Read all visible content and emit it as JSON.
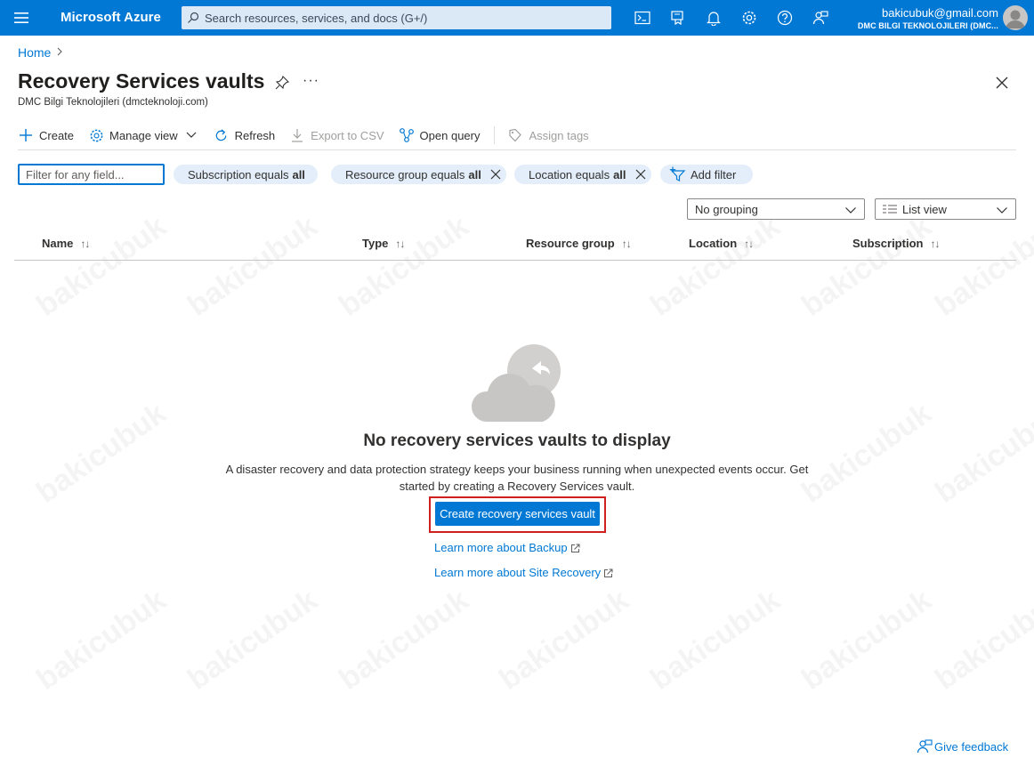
{
  "topbar": {
    "brand": "Microsoft Azure",
    "search_placeholder": "Search resources, services, and docs (G+/)",
    "icons": [
      "cloud-shell-icon",
      "directory-filter-icon",
      "notifications-icon",
      "settings-icon",
      "help-icon",
      "feedback-icon"
    ],
    "account_email": "bakicubuk@gmail.com",
    "account_org": "DMC BILGI TEKNOLOJILERI (DMC..."
  },
  "breadcrumb": {
    "home": "Home"
  },
  "page": {
    "title": "Recovery Services vaults",
    "subtitle": "DMC Bilgi Teknolojileri (dmcteknoloji.com)",
    "more": "···"
  },
  "toolbar": {
    "create": "Create",
    "manage_view": "Manage view",
    "refresh": "Refresh",
    "export_csv": "Export to CSV",
    "open_query": "Open query",
    "assign_tags": "Assign tags"
  },
  "filters": {
    "placeholder": "Filter for any field...",
    "subscription_label": "Subscription equals",
    "subscription_value": "all",
    "resource_group_label": "Resource group equals",
    "resource_group_value": "all",
    "location_label": "Location equals",
    "location_value": "all",
    "add_filter": "Add filter"
  },
  "view": {
    "grouping": "No grouping",
    "list_view": "List view"
  },
  "table": {
    "columns": [
      "Name",
      "Type",
      "Resource group",
      "Location",
      "Subscription"
    ],
    "sort_glyph": "↑↓"
  },
  "empty_state": {
    "title": "No recovery services vaults to display",
    "description": "A disaster recovery and data protection strategy keeps your business running when unexpected events occur. Get started by creating a Recovery Services vault.",
    "create_button": "Create recovery services vault",
    "link_backup": "Learn more about Backup",
    "link_site_recovery": "Learn more about Site Recovery"
  },
  "footer": {
    "feedback": "Give feedback"
  },
  "watermark": "bakicubuk",
  "colors": {
    "accent": "#0078d4",
    "highlight_border": "#d01f1f",
    "pill_bg": "#e3eefa"
  }
}
